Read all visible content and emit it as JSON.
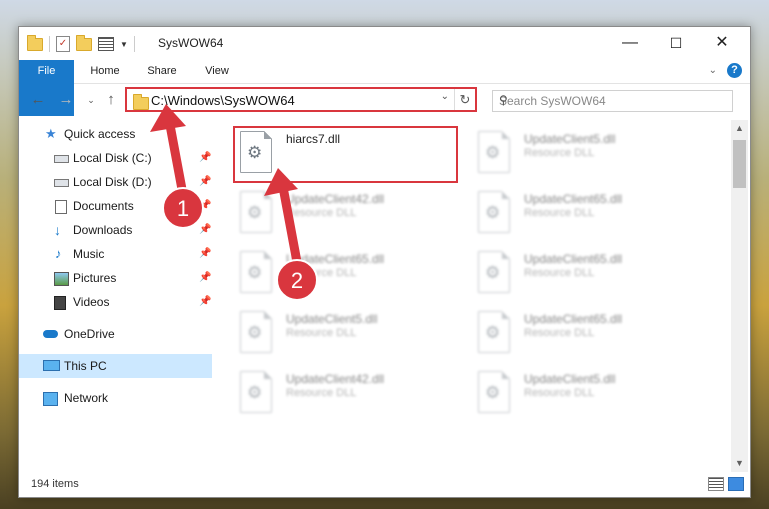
{
  "window": {
    "title": "SysWOW64",
    "controls": {
      "minimize": "—",
      "maximize": "☐",
      "close": "✕"
    }
  },
  "ribbon": {
    "tabs": [
      "File",
      "Home",
      "Share",
      "View"
    ]
  },
  "address": {
    "path": "C:\\Windows\\SysWOW64",
    "search_placeholder": "Search SysWOW64"
  },
  "sidebar": {
    "items": [
      {
        "label": "Quick access",
        "icon": "star-icon",
        "pinned": false
      },
      {
        "label": "Local Disk (C:)",
        "icon": "drive-icon",
        "pinned": true
      },
      {
        "label": "Local Disk (D:)",
        "icon": "drive-icon",
        "pinned": true
      },
      {
        "label": "Documents",
        "icon": "documents-icon",
        "pinned": true
      },
      {
        "label": "Downloads",
        "icon": "download-icon",
        "pinned": true
      },
      {
        "label": "Music",
        "icon": "music-icon",
        "pinned": true
      },
      {
        "label": "Pictures",
        "icon": "pictures-icon",
        "pinned": true
      },
      {
        "label": "Videos",
        "icon": "videos-icon",
        "pinned": true
      },
      {
        "label": "OneDrive",
        "icon": "cloud-icon",
        "pinned": false
      },
      {
        "label": "This PC",
        "icon": "computer-icon",
        "pinned": false,
        "selected": true
      },
      {
        "label": "Network",
        "icon": "network-icon",
        "pinned": false
      }
    ]
  },
  "files": [
    {
      "name": "hiarcs7.dll",
      "type": "",
      "blurred": false,
      "highlighted": true
    },
    {
      "name": "UpdateClient5.dll",
      "type": "Resource DLL",
      "blurred": true
    },
    {
      "name": "UpdateClient42.dll",
      "type": "Resource DLL",
      "blurred": true
    },
    {
      "name": "UpdateClient65.dll",
      "type": "Resource DLL",
      "blurred": true
    },
    {
      "name": "UpdateClient65.dll",
      "type": "Resource DLL",
      "blurred": true
    },
    {
      "name": "UpdateClient65.dll",
      "type": "Resource DLL",
      "blurred": true
    },
    {
      "name": "UpdateClient5.dll",
      "type": "Resource DLL",
      "blurred": true
    },
    {
      "name": "UpdateClient65.dll",
      "type": "Resource DLL",
      "blurred": true
    },
    {
      "name": "UpdateClient42.dll",
      "type": "Resource DLL",
      "blurred": true
    },
    {
      "name": "UpdateClient5.dll",
      "type": "Resource DLL",
      "blurred": true
    }
  ],
  "status": {
    "item_count": "194 items"
  },
  "annotations": {
    "step1": "1",
    "step2": "2",
    "color": "#d9363e"
  }
}
